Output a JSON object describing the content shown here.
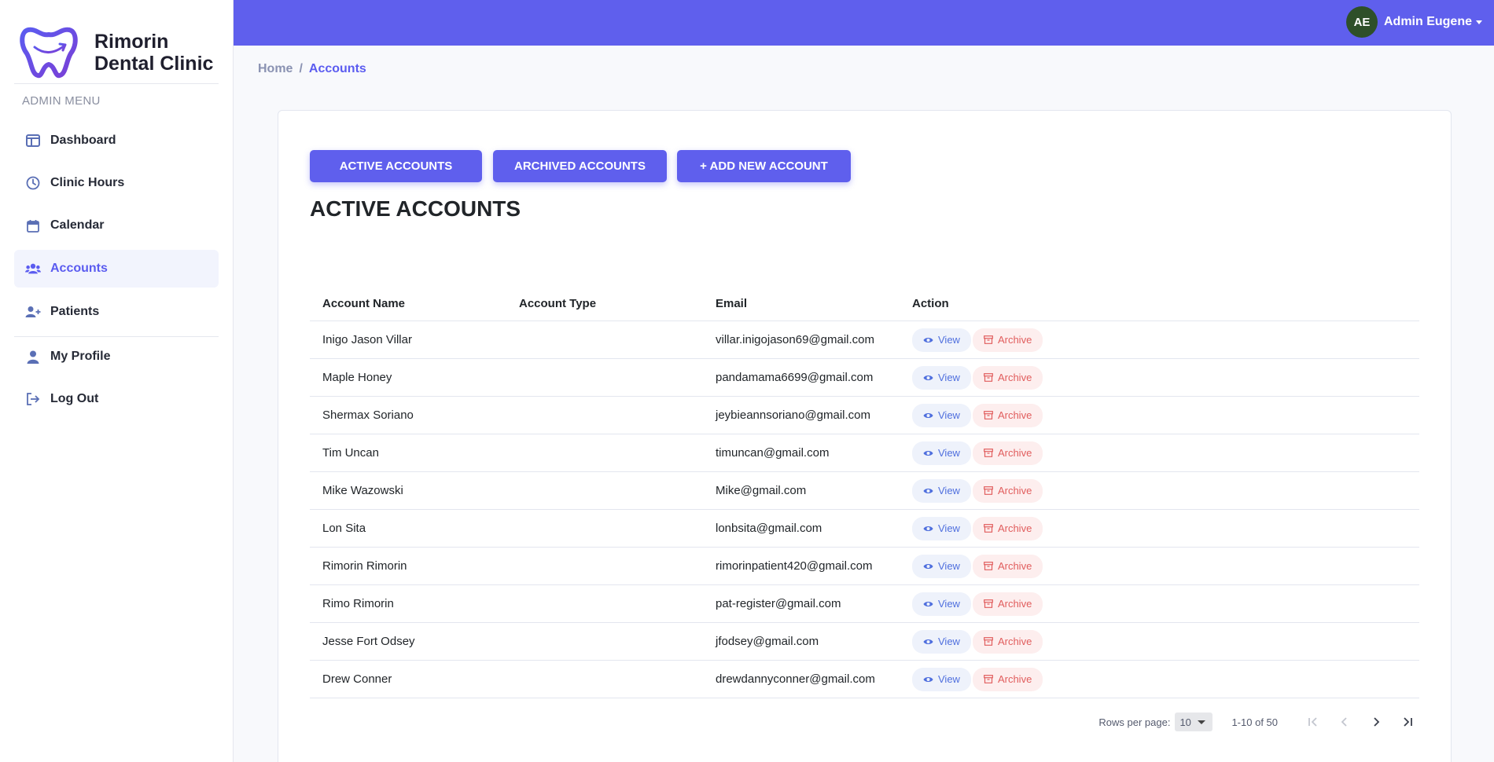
{
  "brand": {
    "line1": "Rimorin",
    "line2": "Dental Clinic"
  },
  "sidebar": {
    "heading": "ADMIN MENU",
    "items": [
      {
        "label": "Dashboard",
        "icon": "dashboard-icon"
      },
      {
        "label": "Clinic Hours",
        "icon": "clock-icon"
      },
      {
        "label": "Calendar",
        "icon": "calendar-icon"
      },
      {
        "label": "Accounts",
        "icon": "users-icon",
        "active": true
      },
      {
        "label": "Patients",
        "icon": "user-plus-icon"
      },
      {
        "label": "My Profile",
        "icon": "user-icon"
      },
      {
        "label": "Log Out",
        "icon": "logout-icon"
      }
    ]
  },
  "topbar": {
    "avatar_initials": "AE",
    "user_name": "Admin Eugene"
  },
  "breadcrumb": {
    "home": "Home",
    "separator": "/",
    "current": "Accounts"
  },
  "tabs": {
    "active": "ACTIVE ACCOUNTS",
    "archived": "ARCHIVED ACCOUNTS",
    "add": "+ ADD NEW ACCOUNT"
  },
  "page_title": "ACTIVE ACCOUNTS",
  "table": {
    "headers": {
      "name": "Account Name",
      "type": "Account Type",
      "email": "Email",
      "action": "Action"
    },
    "view_label": "View",
    "archive_label": "Archive",
    "rows": [
      {
        "name": "Inigo Jason Villar",
        "type": "",
        "email": "villar.inigojason69@gmail.com"
      },
      {
        "name": "Maple Honey",
        "type": "",
        "email": "pandamama6699@gmail.com"
      },
      {
        "name": "Shermax Soriano",
        "type": "",
        "email": "jeybieannsoriano@gmail.com"
      },
      {
        "name": "Tim Uncan",
        "type": "",
        "email": "timuncan@gmail.com"
      },
      {
        "name": "Mike Wazowski",
        "type": "",
        "email": "Mike@gmail.com"
      },
      {
        "name": "Lon Sita",
        "type": "",
        "email": "lonbsita@gmail.com"
      },
      {
        "name": "Rimorin Rimorin",
        "type": "",
        "email": "rimorinpatient420@gmail.com"
      },
      {
        "name": "Rimo Rimorin",
        "type": "",
        "email": "pat-register@gmail.com"
      },
      {
        "name": "Jesse Fort Odsey",
        "type": "",
        "email": "jfodsey@gmail.com"
      },
      {
        "name": "Drew Conner",
        "type": "",
        "email": "drewdannyconner@gmail.com"
      }
    ]
  },
  "pagination": {
    "rows_label": "Rows per page:",
    "rows_value": "10",
    "range": "1-10 of 50"
  },
  "colors": {
    "primary": "#5f5fed",
    "view": "#4f6fde",
    "archive": "#e15d5d",
    "avatar": "#2e4f29"
  }
}
